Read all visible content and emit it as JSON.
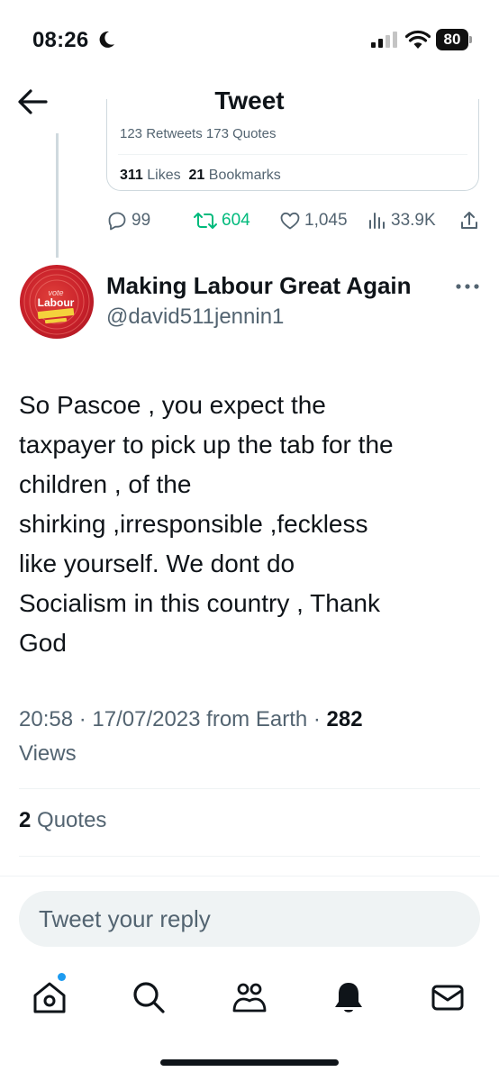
{
  "status_bar": {
    "time": "08:26",
    "battery": "80"
  },
  "header": {
    "title": "Tweet"
  },
  "parent_tweet": {
    "cut_stats": "123 Retweets  173 Quotes",
    "likes_count": "311",
    "likes_label": "Likes",
    "bookmarks_count": "21",
    "bookmarks_label": "Bookmarks",
    "actions": {
      "replies": "99",
      "retweets": "604",
      "likes": "1,045",
      "views": "33.9K"
    }
  },
  "tweet": {
    "author_name": "Making Labour Great Again",
    "author_handle": "@david511jennin1",
    "avatar_text": {
      "line1": "vote",
      "line2": "Labour"
    },
    "text": "So Pascoe , you expect the\ntaxpayer to pick up the tab for the\nchildren , of the\nshirking ,irresponsible ,feckless\nlike yourself. We dont do\nSocialism in this country , Thank\nGod",
    "timestamp": "20:58 · 17/07/2023 from Earth · ",
    "views_count": "282",
    "views_label": "Views",
    "quotes_count": "2",
    "quotes_label": "Quotes"
  },
  "reply": {
    "placeholder": "Tweet your reply"
  },
  "tabs": [
    "home-icon",
    "search-icon",
    "communities-icon",
    "notifications-icon",
    "messages-icon"
  ],
  "colors": {
    "accent": "#1d9bf0",
    "retweet": "#00ba7c",
    "secondary_text": "#536471"
  }
}
